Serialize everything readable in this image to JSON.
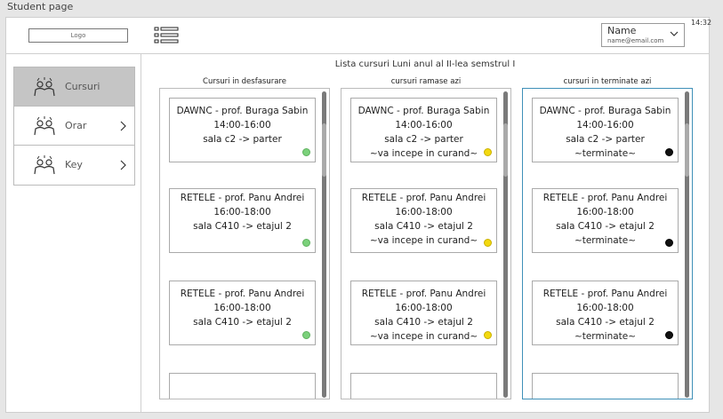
{
  "page": {
    "title": "Student page"
  },
  "header": {
    "logo_text": "Logo",
    "menu_icon": "list-icon",
    "user": {
      "name": "Name",
      "email": "name@email.com",
      "chevron_icon": "chevron-down-icon"
    },
    "clock": "14:32"
  },
  "sidebar": {
    "items": [
      {
        "label": "Cursuri",
        "icon": "people-icon",
        "active": true,
        "has_chevron": false
      },
      {
        "label": "Orar",
        "icon": "people-icon",
        "active": false,
        "has_chevron": true
      },
      {
        "label": "Key",
        "icon": "people-icon",
        "active": false,
        "has_chevron": true
      }
    ]
  },
  "main": {
    "title": "Lista cursuri Luni anul al II-lea semstrul I",
    "columns": [
      {
        "title": "Cursuri in desfasurare",
        "cards": [
          {
            "course": "DAWNC - prof. Buraga Sabin",
            "time": "14:00-16:00",
            "room": "sala c2 -> parter",
            "status": "",
            "dot": "#7bd17b"
          },
          {
            "course": "RETELE - prof. Panu Andrei",
            "time": "16:00-18:00",
            "room": "sala C410 -> etajul 2",
            "status": "",
            "dot": "#7bd17b"
          },
          {
            "course": "RETELE - prof. Panu Andrei",
            "time": "16:00-18:00",
            "room": "sala C410 -> etajul 2",
            "status": "",
            "dot": "#7bd17b"
          }
        ]
      },
      {
        "title": "cursuri ramase azi",
        "cards": [
          {
            "course": "DAWNC - prof. Buraga Sabin",
            "time": "14:00-16:00",
            "room": "sala c2 -> parter",
            "status": "~va incepe in curand~",
            "dot": "#f3d90f"
          },
          {
            "course": "RETELE - prof. Panu Andrei",
            "time": "16:00-18:00",
            "room": "sala C410 -> etajul 2",
            "status": "~va incepe in curand~",
            "dot": "#f3d90f"
          },
          {
            "course": "RETELE - prof. Panu Andrei",
            "time": "16:00-18:00",
            "room": "sala C410 -> etajul 2",
            "status": "~va incepe in curand~",
            "dot": "#f3d90f"
          }
        ]
      },
      {
        "title": "cursuri in terminate azi",
        "cards": [
          {
            "course": "DAWNC - prof. Buraga Sabin",
            "time": "14:00-16:00",
            "room": "sala c2 -> parter",
            "status": "~terminate~",
            "dot": "#111111"
          },
          {
            "course": "RETELE - prof. Panu Andrei",
            "time": "16:00-18:00",
            "room": "sala C410 -> etajul 2",
            "status": "~terminate~",
            "dot": "#111111"
          },
          {
            "course": "RETELE - prof. Panu Andrei",
            "time": "16:00-18:00",
            "room": "sala C410 -> etajul 2",
            "status": "~terminate~",
            "dot": "#111111"
          }
        ]
      }
    ]
  }
}
